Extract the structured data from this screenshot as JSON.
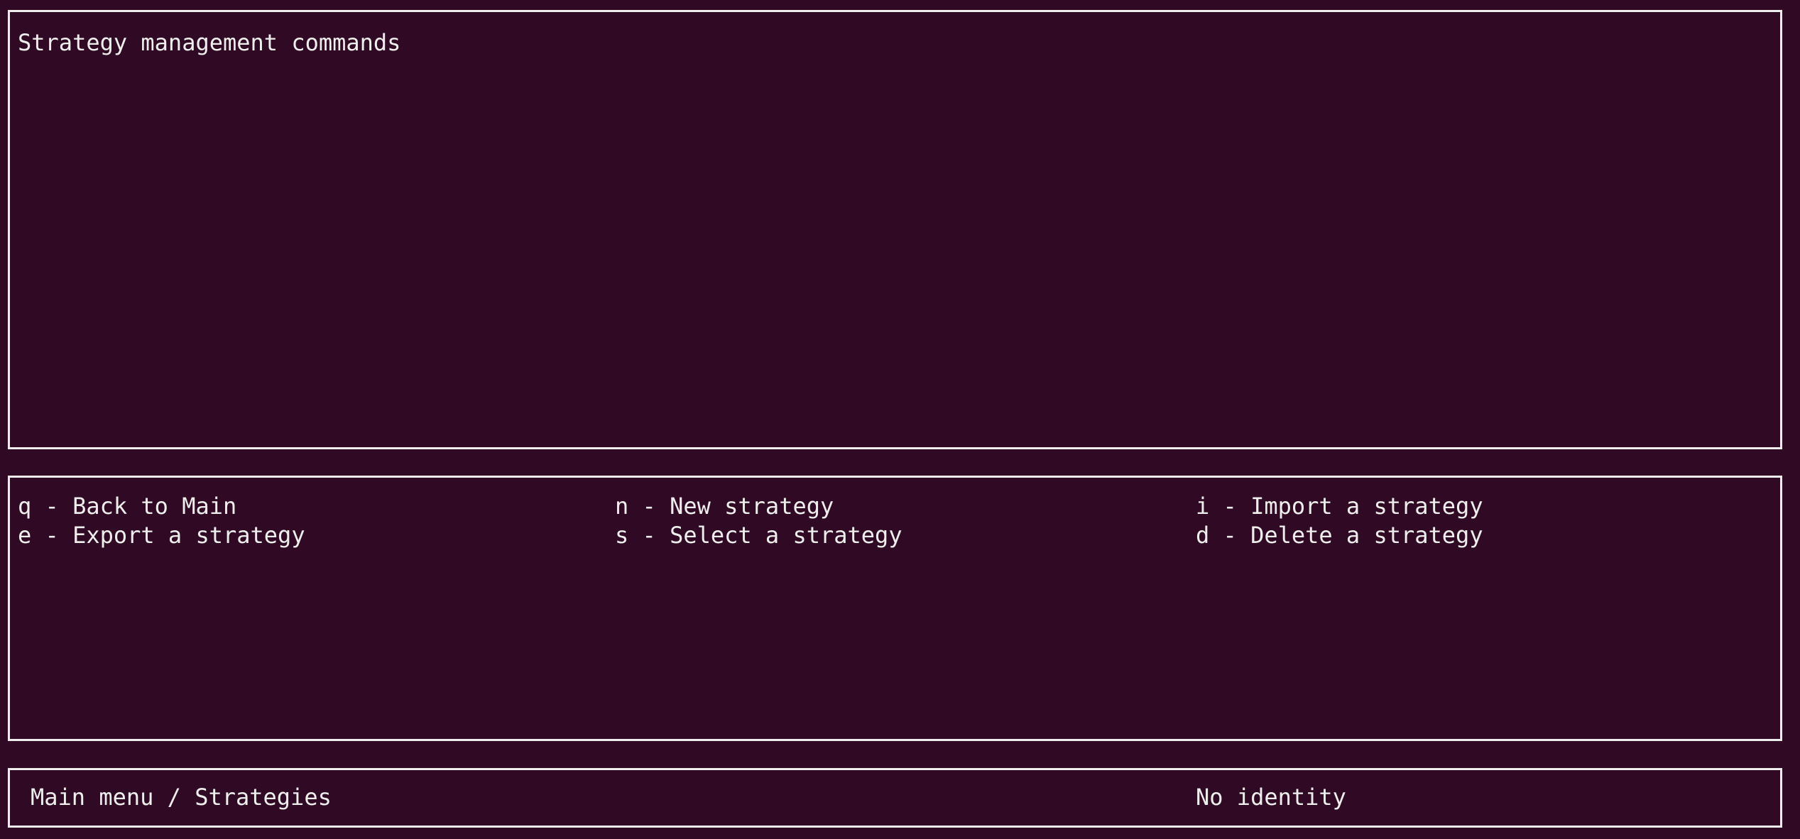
{
  "info_panel": {
    "title": "Strategy management commands"
  },
  "commands": [
    {
      "key": "q",
      "label": "Back to Main",
      "text": "q - Back to Main"
    },
    {
      "key": "n",
      "label": "New strategy",
      "text": "n - New strategy"
    },
    {
      "key": "i",
      "label": "Import a strategy",
      "text": "i - Import a strategy"
    },
    {
      "key": "e",
      "label": "Export a strategy",
      "text": "e - Export a strategy"
    },
    {
      "key": "s",
      "label": "Select a strategy",
      "text": "s - Select a strategy"
    },
    {
      "key": "d",
      "label": "Delete a strategy",
      "text": "d - Delete a strategy"
    }
  ],
  "status_bar": {
    "breadcrumb": "Main menu / Strategies",
    "identity": "No identity"
  },
  "colors": {
    "background": "#300a24",
    "foreground": "#eeeeec"
  }
}
